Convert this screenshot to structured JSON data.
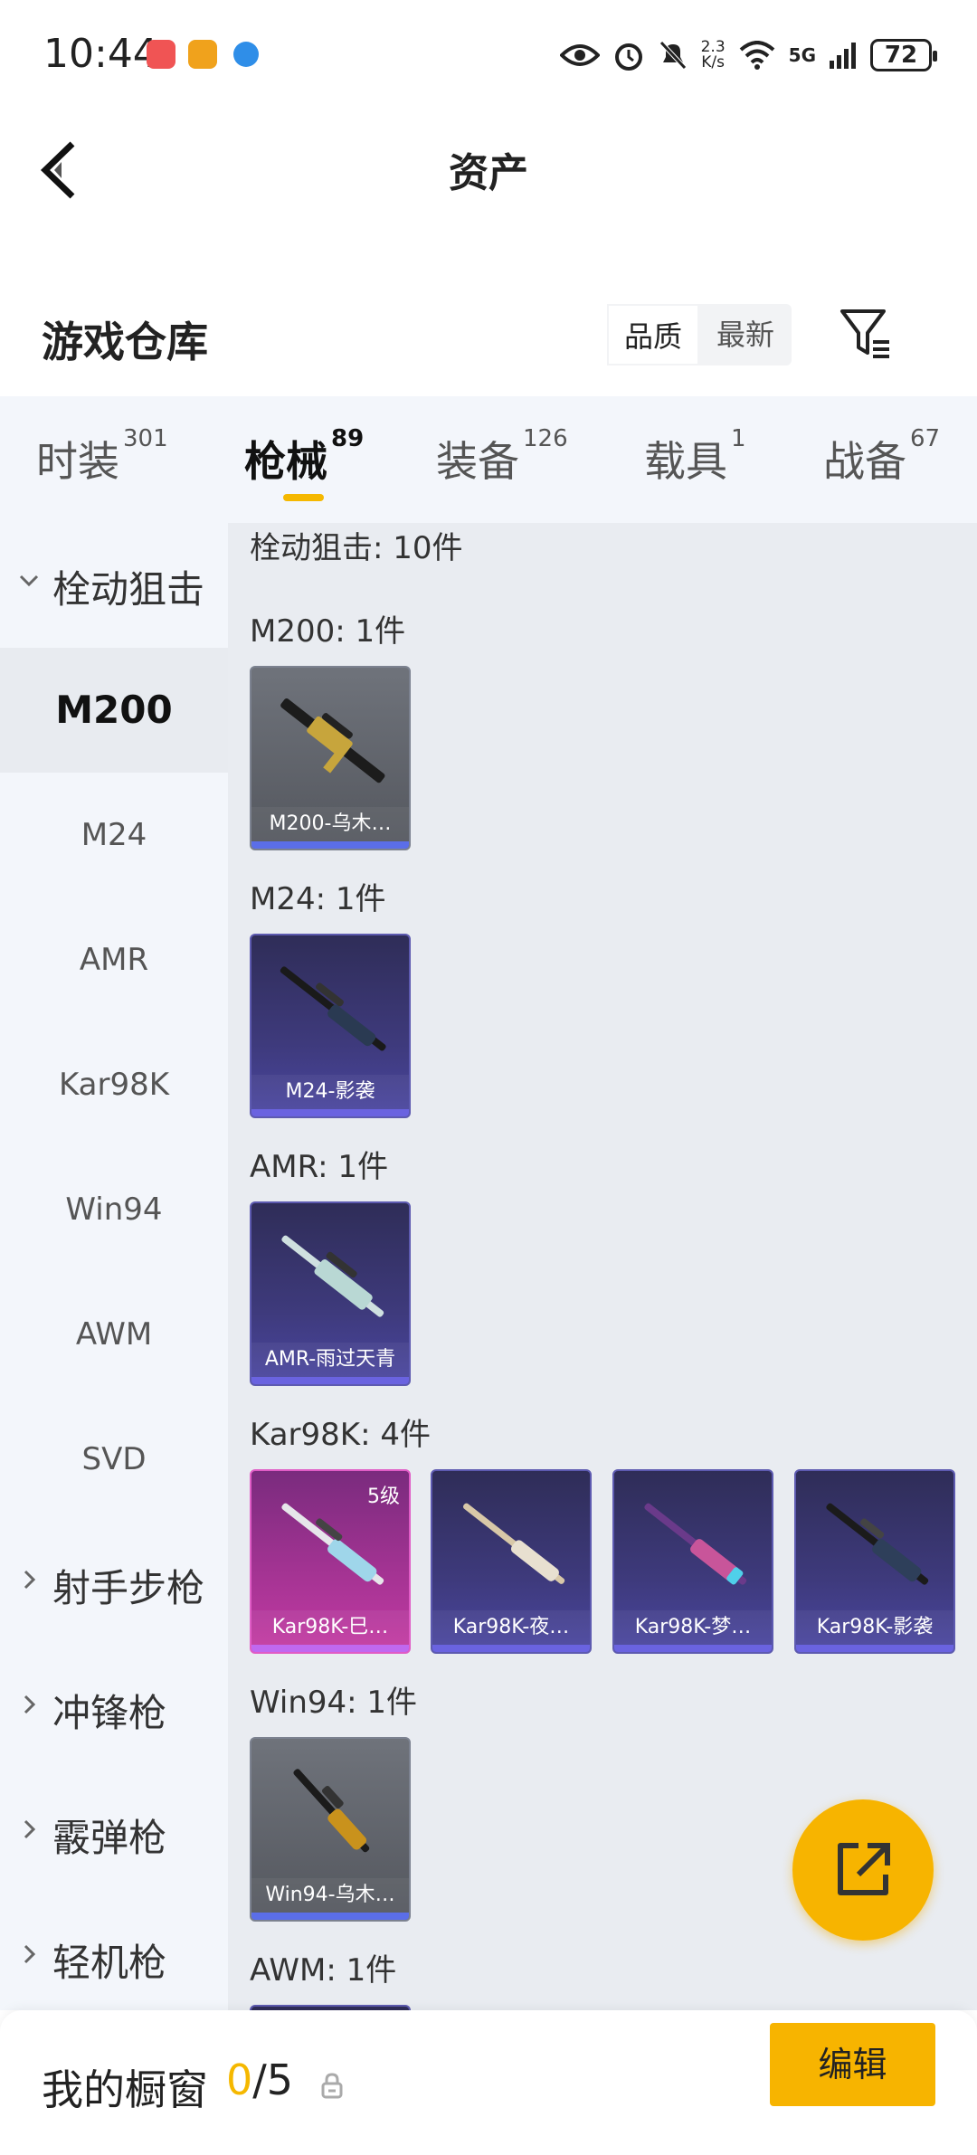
{
  "status_bar": {
    "time": "10:44",
    "net_speed_value": "2.3",
    "net_speed_unit": "K/s",
    "network": "5G",
    "battery": "72"
  },
  "header": {
    "title": "资产"
  },
  "section": {
    "title": "游戏仓库",
    "sort_options": [
      "品质",
      "最新"
    ],
    "sort_selected": "品质"
  },
  "tabs": [
    {
      "label": "时装",
      "count": "301"
    },
    {
      "label": "枪械",
      "count": "89"
    },
    {
      "label": "装备",
      "count": "126"
    },
    {
      "label": "载具",
      "count": "1"
    },
    {
      "label": "战备",
      "count": "67"
    }
  ],
  "sidebar": {
    "expanded_group": "栓动狙击",
    "items": [
      "M200",
      "M24",
      "AMR",
      "Kar98K",
      "Win94",
      "AWM",
      "SVD"
    ],
    "selected": "M200",
    "collapsed_groups": [
      "射手步枪",
      "冲锋枪",
      "霰弹枪",
      "轻机枪"
    ]
  },
  "main": {
    "summary": "栓动狙击: 10件",
    "groups": [
      {
        "label": "M200: 1件",
        "cards": [
          {
            "name": "M200-乌木…",
            "style": "grey"
          }
        ]
      },
      {
        "label": "M24: 1件",
        "cards": [
          {
            "name": "M24-影袭",
            "style": "purple"
          }
        ]
      },
      {
        "label": "AMR: 1件",
        "cards": [
          {
            "name": "AMR-雨过天青",
            "style": "purple"
          }
        ]
      },
      {
        "label": "Kar98K: 4件",
        "cards": [
          {
            "name": "Kar98K-巳…",
            "style": "pink",
            "level": "5级"
          },
          {
            "name": "Kar98K-夜…",
            "style": "purple"
          },
          {
            "name": "Kar98K-梦…",
            "style": "purple"
          },
          {
            "name": "Kar98K-影袭",
            "style": "purple"
          }
        ]
      },
      {
        "label": "Win94: 1件",
        "cards": [
          {
            "name": "Win94-乌木…",
            "style": "grey"
          }
        ]
      },
      {
        "label": "AWM: 1件",
        "cards": []
      }
    ]
  },
  "bottom": {
    "showcase_label": "我的橱窗",
    "showcase_current": "0",
    "showcase_total": "/5",
    "edit_label": "编辑"
  },
  "colors": {
    "accent": "#f7b400",
    "tab_bg": "#f3f6fb",
    "list_bg": "#e9ecf1"
  }
}
